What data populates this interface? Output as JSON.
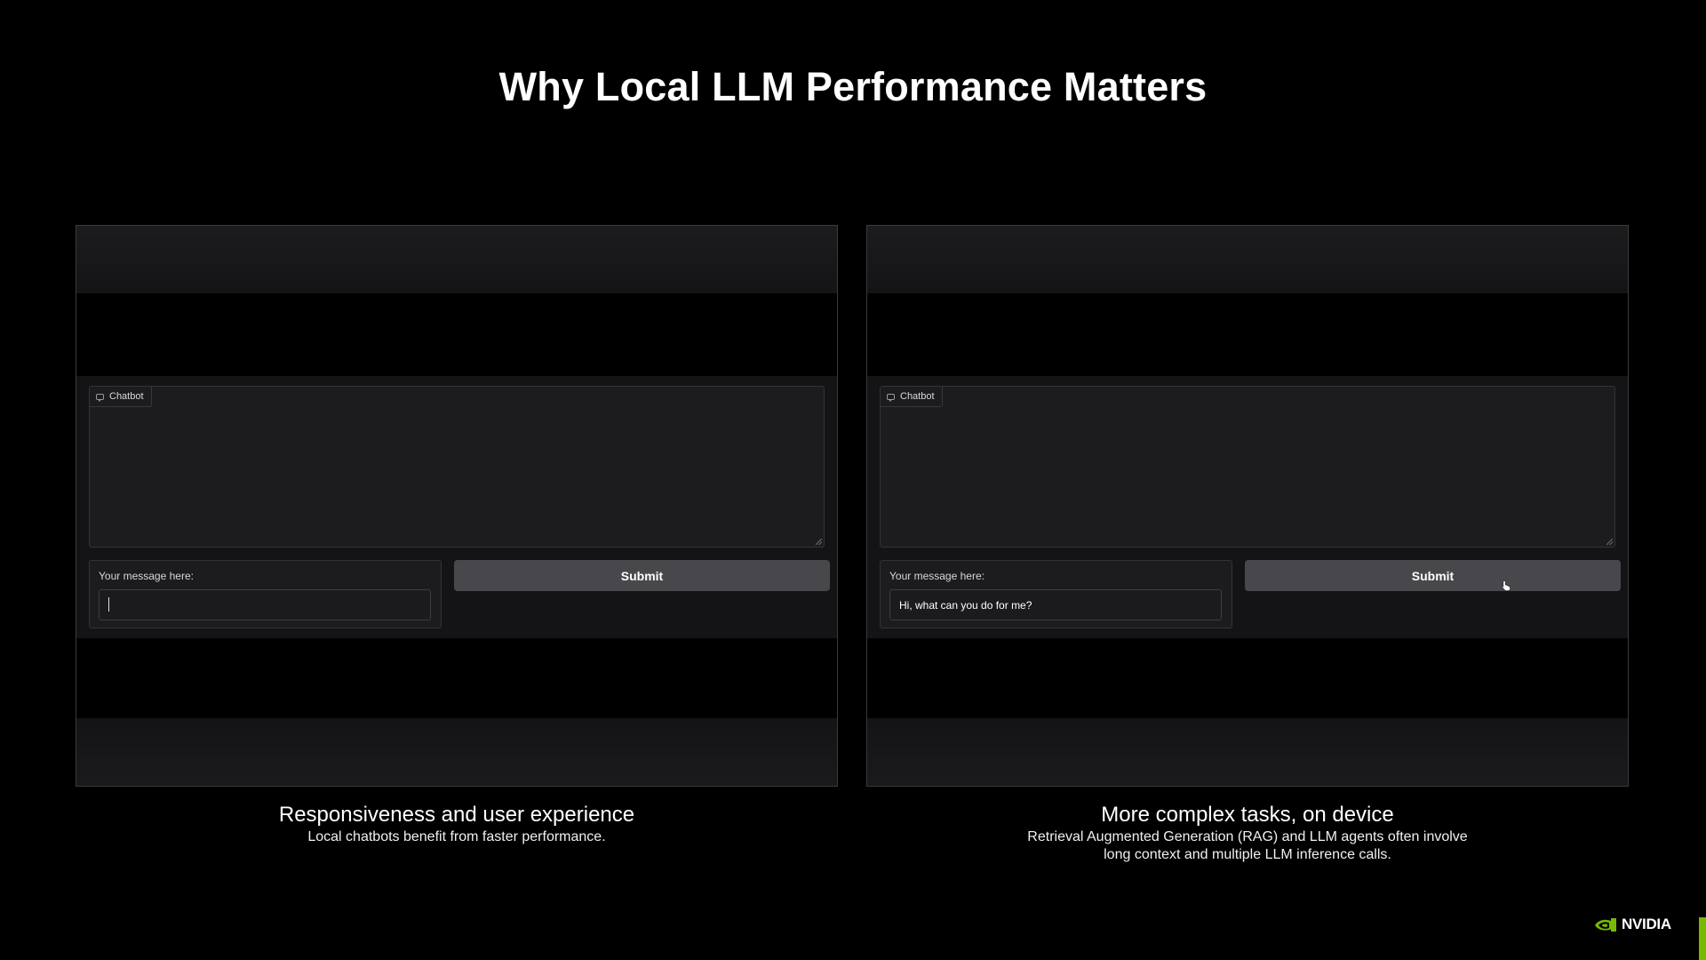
{
  "slide": {
    "title": "Why Local LLM Performance Matters"
  },
  "panels": [
    {
      "chatbot_label": "Chatbot",
      "message_label": "Your message here:",
      "input_value": "",
      "submit_label": "Submit",
      "caption_title": "Responsiveness and user experience",
      "caption_lines": [
        "Local chatbots benefit from faster performance."
      ]
    },
    {
      "chatbot_label": "Chatbot",
      "message_label": "Your message here:",
      "input_value": "Hi, what can you do for me?",
      "submit_label": "Submit",
      "caption_title": "More complex tasks, on device",
      "caption_lines": [
        "Retrieval Augmented Generation (RAG) and LLM agents often involve",
        "long context and multiple LLM inference calls."
      ]
    }
  ],
  "brand": {
    "name": "NVIDIA",
    "accent": "#76b900"
  },
  "icons": {
    "chatbot": "chat-bubble-icon",
    "cursor": "hand-pointer-icon",
    "logo": "nvidia-eye-icon"
  }
}
